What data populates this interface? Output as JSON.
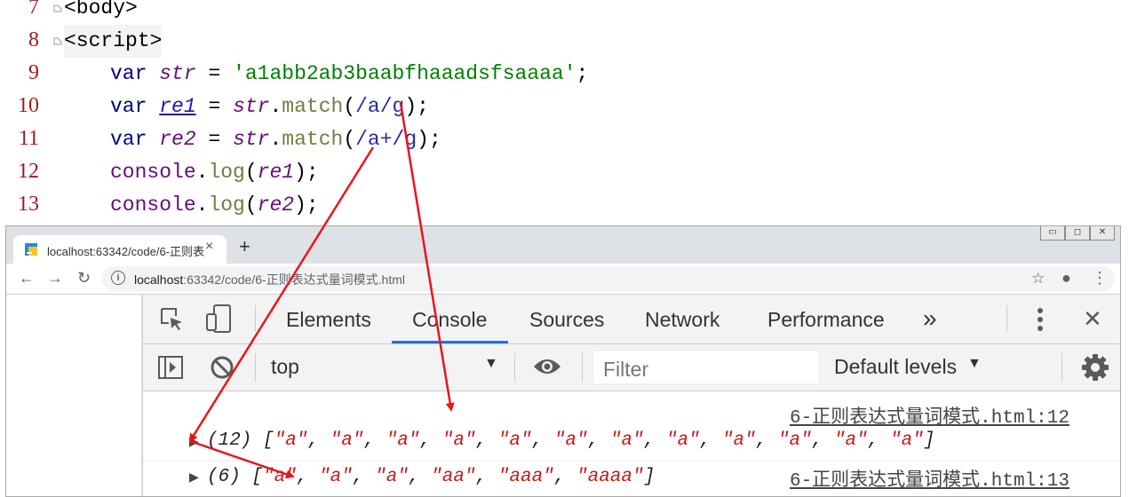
{
  "editor": {
    "line_numbers": [
      "7",
      "8",
      "9",
      "10",
      "11",
      "12",
      "13"
    ],
    "lines": {
      "l7": "<body>",
      "l8": "<script>",
      "l9": {
        "kw": "var ",
        "var": "str",
        "eq": " = ",
        "str": "'a1abb2ab3baabfhaaadsfsaaaa'",
        "end": ";"
      },
      "l10": {
        "kw": "var ",
        "var": "re1",
        "eq": " = ",
        "obj": "str",
        "dot": ".",
        "fn": "match",
        "open": "(",
        "rx": "/a/g",
        "close": ")",
        "end": ";"
      },
      "l11": {
        "kw": "var ",
        "var": "re2",
        "eq": " = ",
        "obj": "str",
        "dot": ".",
        "fn": "match",
        "open": "(",
        "rx": "/a+/g",
        "close": ")",
        "end": ";"
      },
      "l12": {
        "fn_obj": "console",
        "dot": ".",
        "fn": "log",
        "open": "(",
        "arg": "re1",
        "close": ")",
        "end": ";"
      },
      "l13": {
        "fn_obj": "console",
        "dot": ".",
        "fn": "log",
        "open": "(",
        "arg": "re2",
        "close": ")",
        "end": ";"
      }
    }
  },
  "browser": {
    "tab_title": "localhost:63342/code/6-正则表",
    "tab_close": "×",
    "new_tab": "+",
    "window_buttons": [
      "▭",
      "◻",
      "✕"
    ],
    "url_host": "localhost",
    "url_rest": ":63342/code/6-正则表达式量词模式.html",
    "back_icon": "←",
    "forward_icon": "→",
    "reload_icon": "↻",
    "star_icon": "☆",
    "account_icon": "●",
    "menu_icon": "⋮"
  },
  "devtools": {
    "tabs": [
      "Elements",
      "Console",
      "Sources",
      "Network",
      "Performance"
    ],
    "active_tab": "Console",
    "more_tabs": "»",
    "context": "top",
    "filter_placeholder": "Filter",
    "levels": "Default levels",
    "caret": "▼",
    "close": "✕"
  },
  "console": {
    "messages": [
      {
        "source": "6-正则表达式量词模式.html:12",
        "count": "(12)",
        "items": [
          "\"a\"",
          "\"a\"",
          "\"a\"",
          "\"a\"",
          "\"a\"",
          "\"a\"",
          "\"a\"",
          "\"a\"",
          "\"a\"",
          "\"a\"",
          "\"a\"",
          "\"a\""
        ]
      },
      {
        "source": "6-正则表达式量词模式.html:13",
        "count": "(6)",
        "items": [
          "\"a\"",
          "\"a\"",
          "\"a\"",
          "\"aa\"",
          "\"aaa\"",
          "\"aaaa\""
        ]
      }
    ]
  },
  "colors": {
    "annotation_arrow": "#e8161b",
    "active_tab_underline": "#1a73e8"
  }
}
